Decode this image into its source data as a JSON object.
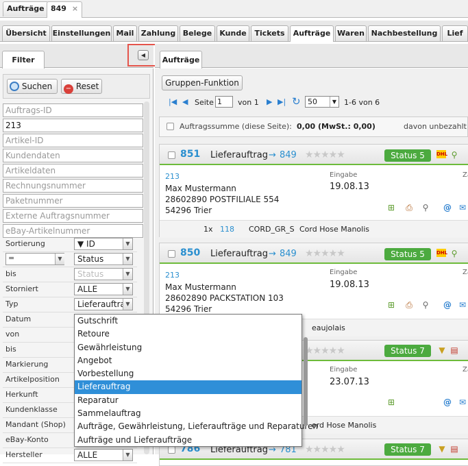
{
  "top_tabs": {
    "a": "Aufträge",
    "b": "849",
    "close": "×"
  },
  "nav_tabs": [
    "Übersicht",
    "Einstellungen",
    "Mail",
    "Zahlung",
    "Belege",
    "Kunde",
    "Tickets",
    "Aufträge",
    "Waren",
    "Nachbestellung",
    "Lief"
  ],
  "filter": {
    "title": "Filter",
    "search_btn": "Suchen",
    "reset_btn": "Reset",
    "inputs": [
      "Auftrags-ID",
      "213",
      "Artikel-ID",
      "Kundendaten",
      "Artikeldaten",
      "Rechnungsnummer",
      "Paketnummer",
      "Externe Auftragsnummer",
      "eBay-Artikelnummer"
    ],
    "rows": [
      {
        "label": "Sortierung",
        "value": "▼ ID"
      },
      {
        "label": "=",
        "value": "Status"
      },
      {
        "label": "bis",
        "value": "Status"
      },
      {
        "label": "Storniert",
        "value": "ALLE"
      },
      {
        "label": "Typ",
        "value": "Lieferauftrag"
      },
      {
        "label": "Datum",
        "value": ""
      },
      {
        "label": "von",
        "value": ""
      },
      {
        "label": "bis",
        "value": ""
      },
      {
        "label": "Markierung",
        "value": ""
      },
      {
        "label": "Artikelposition",
        "value": ""
      },
      {
        "label": "Herkunft",
        "value": ""
      },
      {
        "label": "Kundenklasse",
        "value": ""
      },
      {
        "label": "Mandant (Shop)",
        "value": ""
      },
      {
        "label": "eBay-Konto",
        "value": ""
      },
      {
        "label": "Hersteller",
        "value": "ALLE"
      }
    ]
  },
  "dropdown": {
    "options": [
      "Gutschrift",
      "Retoure",
      "Gewährleistung",
      "Angebot",
      "Vorbestellung",
      "Lieferauftrag",
      "Reparatur",
      "Sammelauftrag",
      "Aufträge, Gewährleistung, Lieferaufträge und Reparaturen",
      "Aufträge und Lieferaufträge"
    ],
    "selected": 5
  },
  "main": {
    "tab": "Aufträge",
    "group_btn": "Gruppen-Funktion",
    "pager": {
      "seite": "Seite",
      "page": "1",
      "von": "von 1",
      "per_page": "50",
      "range": "1-6 von 6"
    },
    "summary": {
      "label": "Auftragssumme (diese Seite):",
      "value": "0,00 (MwSt.: 0,00)",
      "unpaid": "davon unbezahlt:"
    }
  },
  "orders": [
    {
      "id": "851",
      "type": "Lieferauftrag",
      "arrow": "→",
      "ref": "849",
      "status": "Status 5",
      "customer_id": "213",
      "name": "Max Mustermann",
      "addr1": "28602890 POSTFILIALE 554",
      "addr2": "54296 Trier",
      "eingabe_label": "Eingabe",
      "eingabe": "19.08.13",
      "za": "Za",
      "qty": "1x",
      "art": "118",
      "sku": "CORD_GR_S",
      "desc": "Cord Hose Manolis"
    },
    {
      "id": "850",
      "type": "Lieferauftrag",
      "arrow": "→",
      "ref": "849",
      "status": "Status 5",
      "customer_id": "213",
      "name": "Max Mustermann",
      "addr1": "28602890 PACKSTATION 103",
      "addr2": "54296 Trier",
      "eingabe_label": "Eingabe",
      "eingabe": "19.08.13",
      "za": "Za",
      "desc": "eaujolais"
    },
    {
      "status": "Status 7",
      "eingabe_label": "Eingabe",
      "eingabe": "23.07.13",
      "za": "Za",
      "desc": "ord Hose Manolis"
    },
    {
      "id": "786",
      "type": "Lieferauftrag",
      "arrow": "→",
      "ref": "781",
      "status": "Status 7"
    }
  ]
}
